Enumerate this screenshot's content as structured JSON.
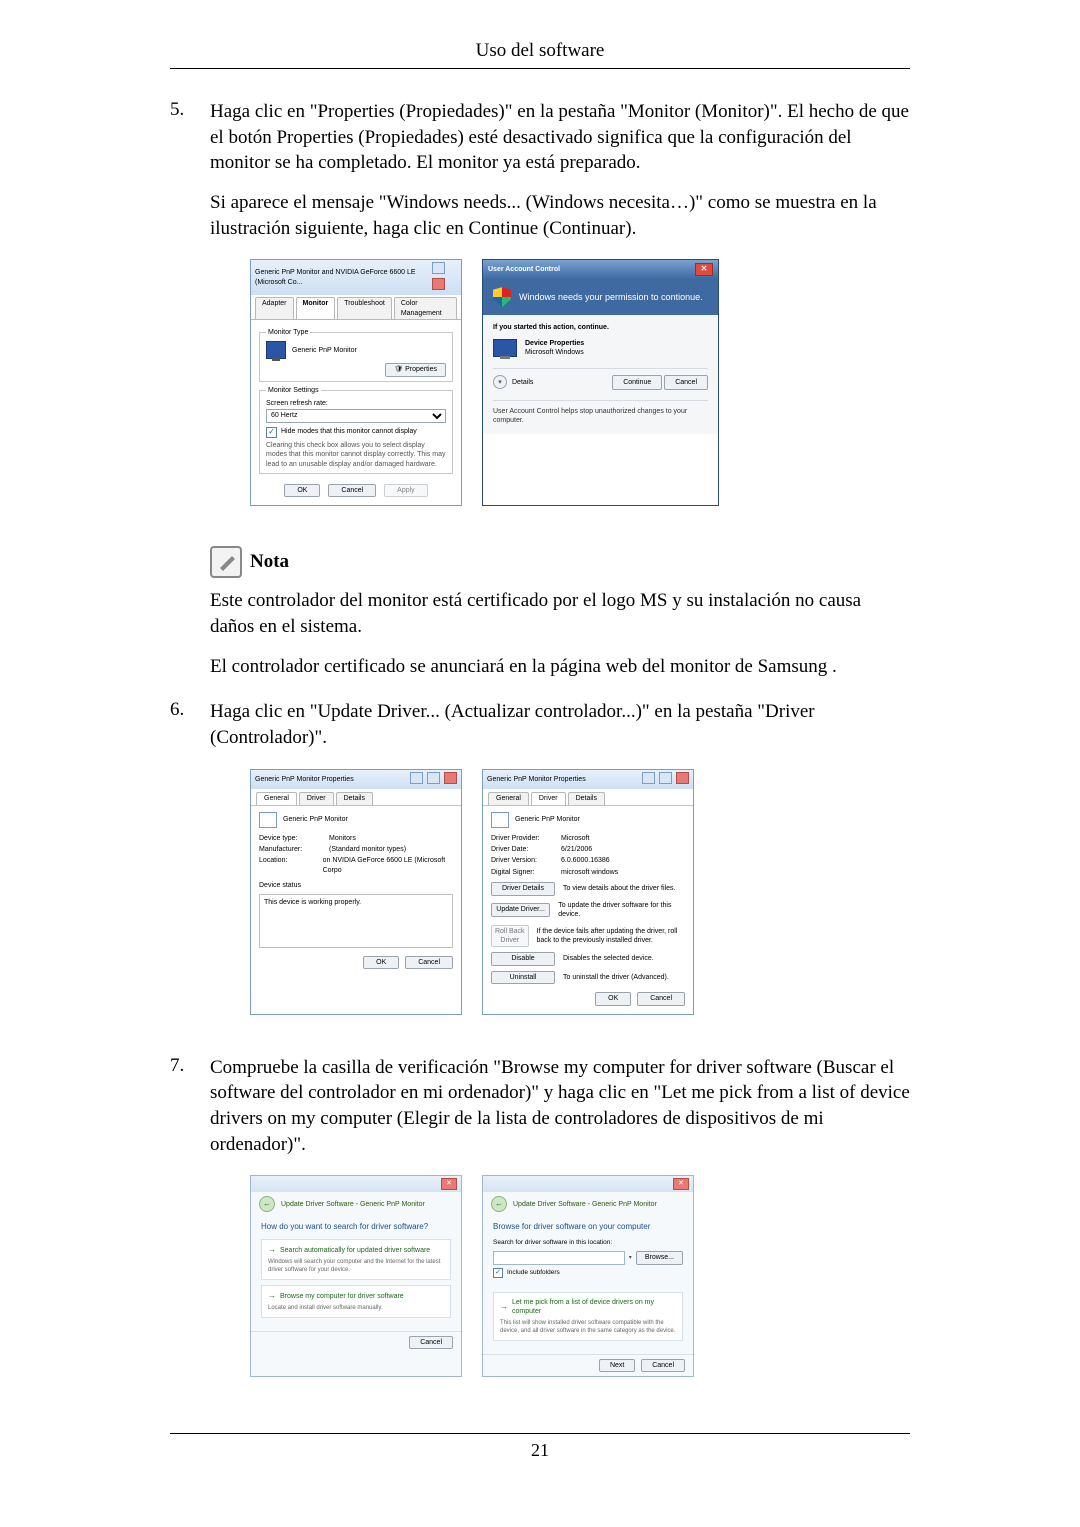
{
  "doc": {
    "header": "Uso del software",
    "page_number": "21"
  },
  "steps": {
    "s5": {
      "num": "5.",
      "p1": "Haga clic en \"Properties (Propiedades)\" en la pestaña \"Monitor (Monitor)\". El hecho de que el botón Properties (Propiedades) esté desactivado significa que la configuración del monitor se ha completado. El monitor ya está preparado.",
      "p2": "Si aparece el mensaje \"Windows needs... (Windows necesita…)\" como se muestra en la ilustración siguiente, haga clic en Continue (Continuar)."
    },
    "s6": {
      "num": "6.",
      "p1": "Haga clic en \"Update Driver... (Actualizar controlador...)\" en la pestaña \"Driver (Controlador)\"."
    },
    "s7": {
      "num": "7.",
      "p1": "Compruebe la casilla de verificación \"Browse my computer for driver software (Buscar el software del controlador en mi ordenador)\" y haga clic en \"Let me pick from a list of device drivers on my computer (Elegir de la lista de controladores de dispositivos de mi ordenador)\"."
    }
  },
  "nota": {
    "label": "Nota",
    "p1": "Este controlador del monitor está certificado por el logo MS y su instalación no causa daños en el sistema.",
    "p2": "El controlador certificado se anunciará en la página web del monitor de Samsung ."
  },
  "figA": {
    "title": "Generic PnP Monitor and NVIDIA GeForce 6600 LE (Microsoft Co...",
    "tabs": {
      "adapter": "Adapter",
      "monitor": "Monitor",
      "troubleshoot": "Troubleshoot",
      "color": "Color Management"
    },
    "group_monitor_type": "Monitor Type",
    "monitor_name": "Generic PnP Monitor",
    "properties_btn": "Properties",
    "group_monitor_settings": "Monitor Settings",
    "refresh_label": "Screen refresh rate:",
    "refresh_value": "60 Hertz",
    "hide_modes": "Hide modes that this monitor cannot display",
    "hide_modes_desc": "Clearing this check box allows you to select display modes that this monitor cannot display correctly. This may lead to an unusable display and/or damaged hardware.",
    "ok": "OK",
    "cancel": "Cancel",
    "apply": "Apply"
  },
  "figB": {
    "title": "User Account Control",
    "headline": "Windows needs your permission to contionue.",
    "started": "If you started this action, continue.",
    "app_name": "Device Properties",
    "publisher": "Microsoft Windows",
    "details": "Details",
    "continue": "Continue",
    "cancel": "Cancel",
    "footer": "User Account Control helps stop unauthorized changes to your computer."
  },
  "figC": {
    "title": "Generic PnP Monitor Properties",
    "tabs": {
      "general": "General",
      "driver": "Driver",
      "details": "Details"
    },
    "name": "Generic PnP Monitor",
    "kv": {
      "devtype_k": "Device type:",
      "devtype_v": "Monitors",
      "manu_k": "Manufacturer:",
      "manu_v": "(Standard monitor types)",
      "loc_k": "Location:",
      "loc_v": "on NVIDIA GeForce 6600 LE (Microsoft Corpo"
    },
    "status_label": "Device status",
    "status_text": "This device is working properly.",
    "ok": "OK",
    "cancel": "Cancel"
  },
  "figD": {
    "title": "Generic PnP Monitor Properties",
    "tabs": {
      "general": "General",
      "driver": "Driver",
      "details": "Details"
    },
    "name": "Generic PnP Monitor",
    "kv": {
      "prov_k": "Driver Provider:",
      "prov_v": "Microsoft",
      "date_k": "Driver Date:",
      "date_v": "6/21/2006",
      "ver_k": "Driver Version:",
      "ver_v": "6.0.6000.16386",
      "sig_k": "Digital Signer:",
      "sig_v": "microsoft windows"
    },
    "btns": {
      "details": "Driver Details",
      "details_d": "To view details about the driver files.",
      "update": "Update Driver...",
      "update_d": "To update the driver software for this device.",
      "rollback": "Roll Back Driver",
      "rollback_d": "If the device fails after updating the driver, roll back to the previously installed driver.",
      "disable": "Disable",
      "disable_d": "Disables the selected device.",
      "uninstall": "Uninstall",
      "uninstall_d": "To uninstall the driver (Advanced)."
    },
    "ok": "OK",
    "cancel": "Cancel"
  },
  "figE": {
    "crumb": "Update Driver Software - Generic PnP Monitor",
    "heading": "How do you want to search for driver software?",
    "opt1_t": "Search automatically for updated driver software",
    "opt1_d": "Windows will search your computer and the Internet for the latest driver software for your device.",
    "opt2_t": "Browse my computer for driver software",
    "opt2_d": "Locate and install driver software manually.",
    "cancel": "Cancel"
  },
  "figF": {
    "crumb": "Update Driver Software - Generic PnP Monitor",
    "heading": "Browse for driver software on your computer",
    "search_label": "Search for driver software in this location:",
    "browse": "Browse...",
    "include_sub": "Include subfolders",
    "opt_t": "Let me pick from a list of device drivers on my computer",
    "opt_d": "This list will show installed driver software compatible with the device, and all driver software in the same category as the device.",
    "next": "Next",
    "cancel": "Cancel"
  }
}
